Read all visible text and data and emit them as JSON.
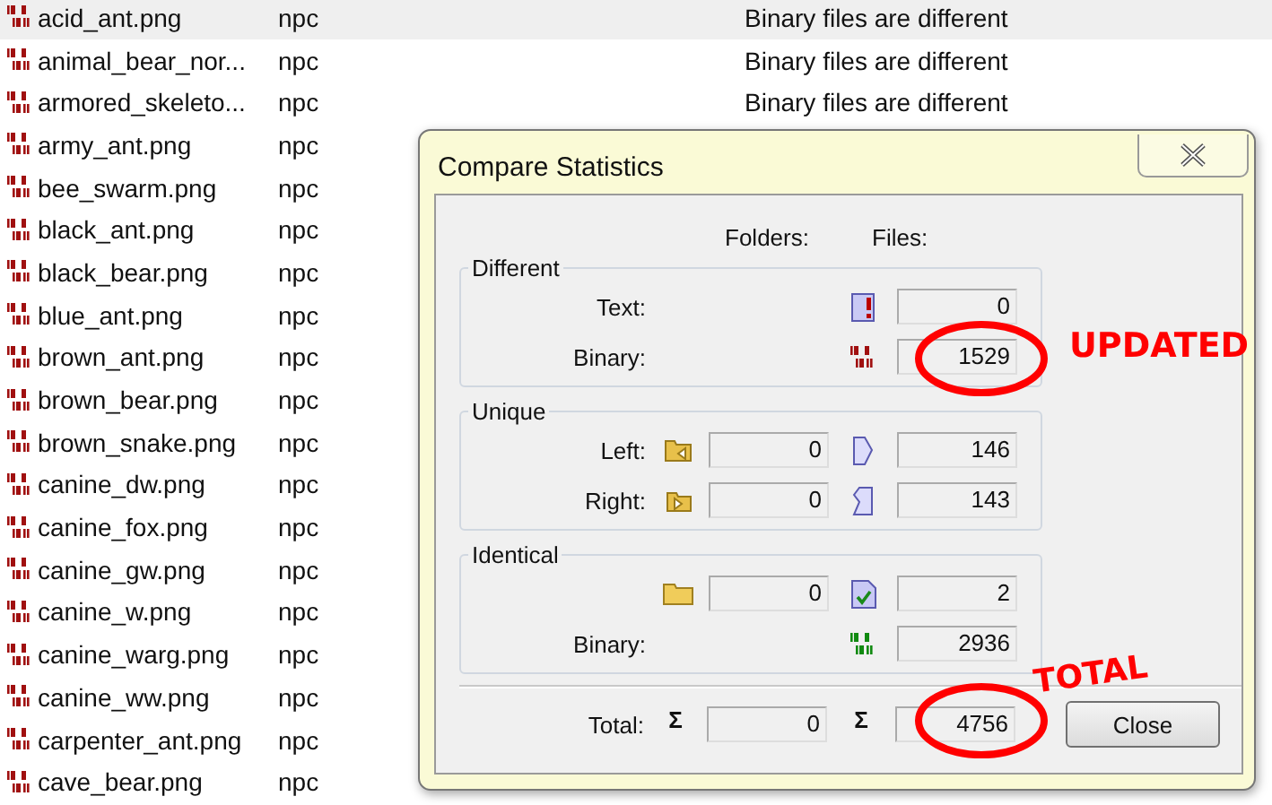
{
  "file_list": {
    "rows": [
      {
        "name": "acid_ant.png",
        "folder": "npc",
        "result": "Binary files are different",
        "selected": true
      },
      {
        "name": "animal_bear_nor...",
        "folder": "npc",
        "result": "Binary files are different",
        "selected": false
      },
      {
        "name": "armored_skeleto...",
        "folder": "npc",
        "result": "Binary files are different",
        "selected": false
      },
      {
        "name": "army_ant.png",
        "folder": "npc",
        "selected": false
      },
      {
        "name": "bee_swarm.png",
        "folder": "npc",
        "selected": false
      },
      {
        "name": "black_ant.png",
        "folder": "npc",
        "selected": false
      },
      {
        "name": "black_bear.png",
        "folder": "npc",
        "selected": false
      },
      {
        "name": "blue_ant.png",
        "folder": "npc",
        "selected": false
      },
      {
        "name": "brown_ant.png",
        "folder": "npc",
        "selected": false
      },
      {
        "name": "brown_bear.png",
        "folder": "npc",
        "selected": false
      },
      {
        "name": "brown_snake.png",
        "folder": "npc",
        "selected": false
      },
      {
        "name": "canine_dw.png",
        "folder": "npc",
        "selected": false
      },
      {
        "name": "canine_fox.png",
        "folder": "npc",
        "selected": false
      },
      {
        "name": "canine_gw.png",
        "folder": "npc",
        "selected": false
      },
      {
        "name": "canine_w.png",
        "folder": "npc",
        "selected": false
      },
      {
        "name": "canine_warg.png",
        "folder": "npc",
        "selected": false
      },
      {
        "name": "canine_ww.png",
        "folder": "npc",
        "selected": false
      },
      {
        "name": "carpenter_ant.png",
        "folder": "npc",
        "selected": false
      },
      {
        "name": "cave_bear.png",
        "folder": "npc",
        "selected": false
      }
    ]
  },
  "dialog": {
    "title": "Compare Statistics",
    "headers": [
      "Folders:",
      "Files:"
    ],
    "groups": [
      {
        "title": "Different",
        "rows": [
          {
            "kind": "text",
            "label": "Text:",
            "files": "0"
          },
          {
            "kind": "binary_diff",
            "label": "Binary:",
            "files": "1529"
          }
        ]
      },
      {
        "title": "Unique",
        "rows": [
          {
            "kind": "left",
            "label": "Left:",
            "folders": "0",
            "files": "146"
          },
          {
            "kind": "right",
            "label": "Right:",
            "folders": "0",
            "files": "143"
          }
        ]
      },
      {
        "title": "Identical",
        "rows": [
          {
            "kind": "identical",
            "folders": "0",
            "files": "2"
          },
          {
            "kind": "binary_same",
            "label": "Binary:",
            "files": "2936"
          }
        ]
      }
    ],
    "total": {
      "label": "Total:",
      "folder_symbol": "Σ",
      "folders": "0",
      "file_symbol": "Σ",
      "files": "4756"
    },
    "close_button": "Close"
  },
  "annotations": [
    {
      "text": "UPDATED"
    },
    {
      "text": "TOTAL"
    }
  ]
}
